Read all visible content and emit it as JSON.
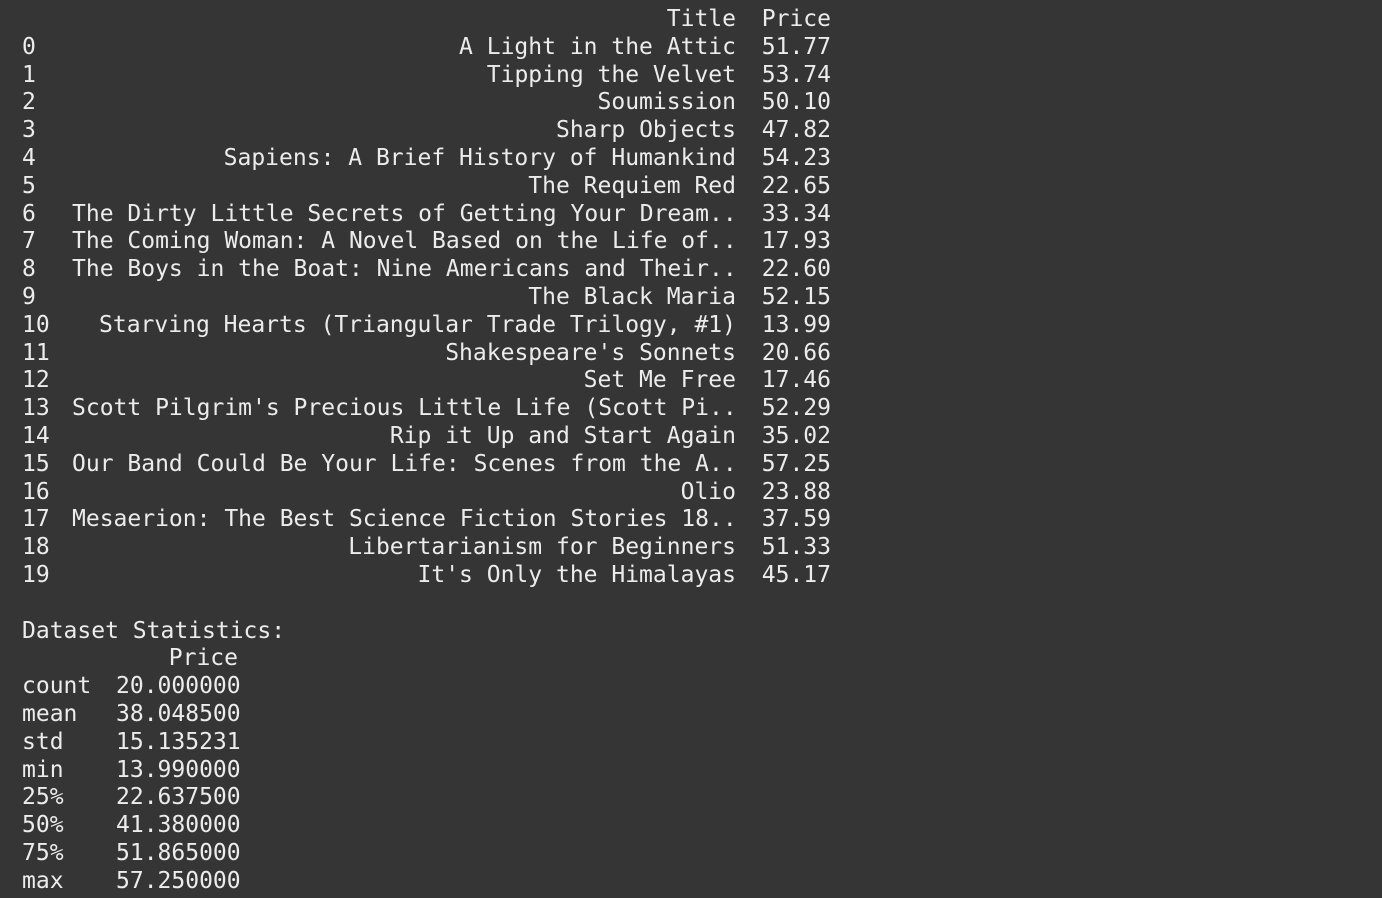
{
  "dataframe": {
    "columns": [
      "Title",
      "Price"
    ],
    "rows": [
      {
        "index": "0",
        "title": "A Light in the Attic",
        "price": "51.77"
      },
      {
        "index": "1",
        "title": "Tipping the Velvet",
        "price": "53.74"
      },
      {
        "index": "2",
        "title": "Soumission",
        "price": "50.10"
      },
      {
        "index": "3",
        "title": "Sharp Objects",
        "price": "47.82"
      },
      {
        "index": "4",
        "title": "Sapiens: A Brief History of Humankind",
        "price": "54.23"
      },
      {
        "index": "5",
        "title": "The Requiem Red",
        "price": "22.65"
      },
      {
        "index": "6",
        "title": "The Dirty Little Secrets of Getting Your Dream...",
        "price": "33.34"
      },
      {
        "index": "7",
        "title": "The Coming Woman: A Novel Based on the Life of...",
        "price": "17.93"
      },
      {
        "index": "8",
        "title": "The Boys in the Boat: Nine Americans and Their...",
        "price": "22.60"
      },
      {
        "index": "9",
        "title": "The Black Maria",
        "price": "52.15"
      },
      {
        "index": "10",
        "title": "Starving Hearts (Triangular Trade Trilogy, #1)",
        "price": "13.99"
      },
      {
        "index": "11",
        "title": "Shakespeare's Sonnets",
        "price": "20.66"
      },
      {
        "index": "12",
        "title": "Set Me Free",
        "price": "17.46"
      },
      {
        "index": "13",
        "title": "Scott Pilgrim's Precious Little Life (Scott Pi...",
        "price": "52.29"
      },
      {
        "index": "14",
        "title": "Rip it Up and Start Again",
        "price": "35.02"
      },
      {
        "index": "15",
        "title": "Our Band Could Be Your Life: Scenes from the A...",
        "price": "57.25"
      },
      {
        "index": "16",
        "title": "Olio",
        "price": "23.88"
      },
      {
        "index": "17",
        "title": "Mesaerion: The Best Science Fiction Stories 18...",
        "price": "37.59"
      },
      {
        "index": "18",
        "title": "Libertarianism for Beginners",
        "price": "51.33"
      },
      {
        "index": "19",
        "title": "It's Only the Himalayas",
        "price": "45.17"
      }
    ]
  },
  "statistics": {
    "heading": "Dataset Statistics:",
    "column": "Price",
    "rows": [
      {
        "label": "count",
        "value": "20.000000"
      },
      {
        "label": "mean",
        "value": "38.048500"
      },
      {
        "label": "std",
        "value": "15.135231"
      },
      {
        "label": "min",
        "value": "13.990000"
      },
      {
        "label": "25%",
        "value": "22.637500"
      },
      {
        "label": "50%",
        "value": "41.380000"
      },
      {
        "label": "75%",
        "value": "51.865000"
      },
      {
        "label": "max",
        "value": "57.250000"
      }
    ]
  },
  "colors": {
    "background": "#353535",
    "text": "#ececec"
  }
}
